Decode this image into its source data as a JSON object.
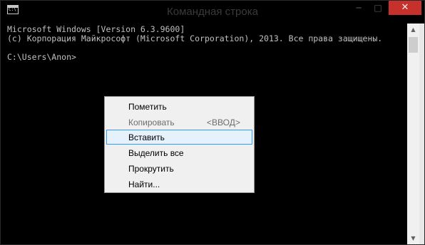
{
  "window": {
    "title": "Командная строка",
    "icon": "command-prompt-icon",
    "icon_text": "C:\\",
    "minimize_symbol": "─",
    "maximize_symbol": "□",
    "close_symbol": "✕"
  },
  "console": {
    "lines": [
      "Microsoft Windows [Version 6.3.9600]",
      "(c) Корпорация Майкрософт (Microsoft Corporation), 2013. Все права защищены.",
      "",
      "C:\\Users\\Anon>"
    ],
    "text_color": "#c0c0c0",
    "background": "#000000"
  },
  "scrollbar": {
    "up_symbol": "▲",
    "down_symbol": "▼"
  },
  "context_menu": {
    "items": [
      {
        "label": "Пометить",
        "shortcut": "",
        "enabled": true,
        "highlighted": false
      },
      {
        "label": "Копировать",
        "shortcut": "<ВВОД>",
        "enabled": false,
        "highlighted": false
      },
      {
        "label": "Вставить",
        "shortcut": "",
        "enabled": true,
        "highlighted": true
      },
      {
        "label": "Выделить все",
        "shortcut": "",
        "enabled": true,
        "highlighted": false
      },
      {
        "label": "Прокрутить",
        "shortcut": "",
        "enabled": true,
        "highlighted": false
      },
      {
        "label": "Найти...",
        "shortcut": "",
        "enabled": true,
        "highlighted": false
      }
    ],
    "highlight_color": "#e5f1fb",
    "highlight_border": "#3399ff"
  }
}
